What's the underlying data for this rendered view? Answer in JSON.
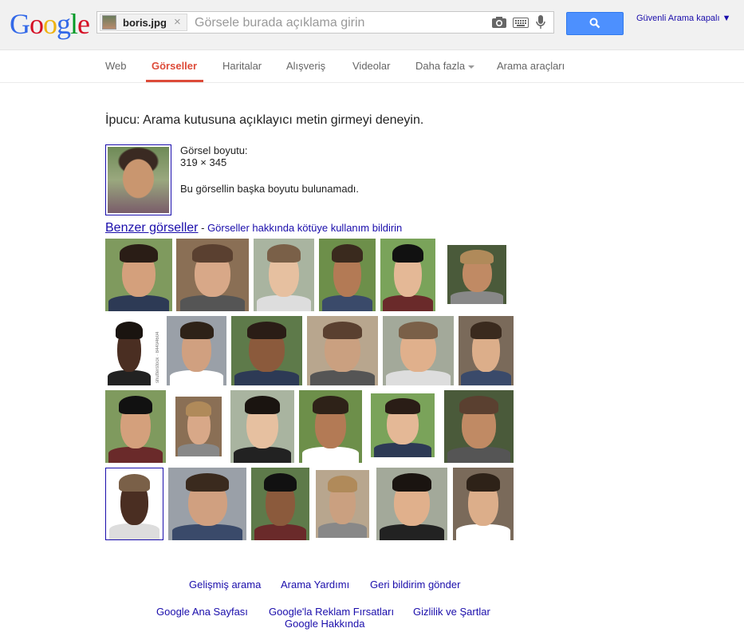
{
  "header": {
    "logo_letters": [
      {
        "ch": "G",
        "color": "#3369e8"
      },
      {
        "ch": "o",
        "color": "#d50f25"
      },
      {
        "ch": "o",
        "color": "#eeb211"
      },
      {
        "ch": "g",
        "color": "#3369e8"
      },
      {
        "ch": "l",
        "color": "#009925"
      },
      {
        "ch": "e",
        "color": "#d50f25"
      }
    ],
    "chip_filename": "boris.jpg",
    "chip_close": "×",
    "search_placeholder": "Görsele burada açıklama girin",
    "icons": [
      "camera-icon",
      "keyboard-icon",
      "microphone-icon",
      "search-icon"
    ],
    "safe_search": "Güvenli Arama kapalı ▼"
  },
  "nav": {
    "items": [
      {
        "label": "Web"
      },
      {
        "label": "Görseller",
        "active": true
      },
      {
        "label": "Haritalar"
      },
      {
        "label": "Alışveriş"
      },
      {
        "label": "Videolar"
      },
      {
        "label": "Daha fazla"
      },
      {
        "label": "Arama araçları"
      }
    ]
  },
  "main": {
    "tip": "İpucu: Arama kutusuna açıklayıcı metin girmeyi deneyin.",
    "image_size_label": "Görsel boyutu:",
    "image_size_value": "319 × 345",
    "no_other_sizes": "Bu görsellin başka boyutu bulunamadı.",
    "similar_images": "Benzer görseller",
    "separator": " - ",
    "report_abuse": "Görseller hakkında kötüye kullanım bildirin",
    "thumb_caption": "shutterstock · 84494604"
  },
  "footer": {
    "row1": [
      "Gelişmiş arama",
      "Arama Yardımı",
      "Geri bildirim gönder"
    ],
    "row2": [
      "Google Ana Sayfası",
      "Google'la Reklam Fırsatları",
      "Gizlilik ve Şartlar"
    ],
    "row3": [
      "Google Hakkında"
    ]
  },
  "colors": {
    "link": "#1a0dab",
    "active_tab": "#dd4b39",
    "search_button": "#4d90fe"
  }
}
